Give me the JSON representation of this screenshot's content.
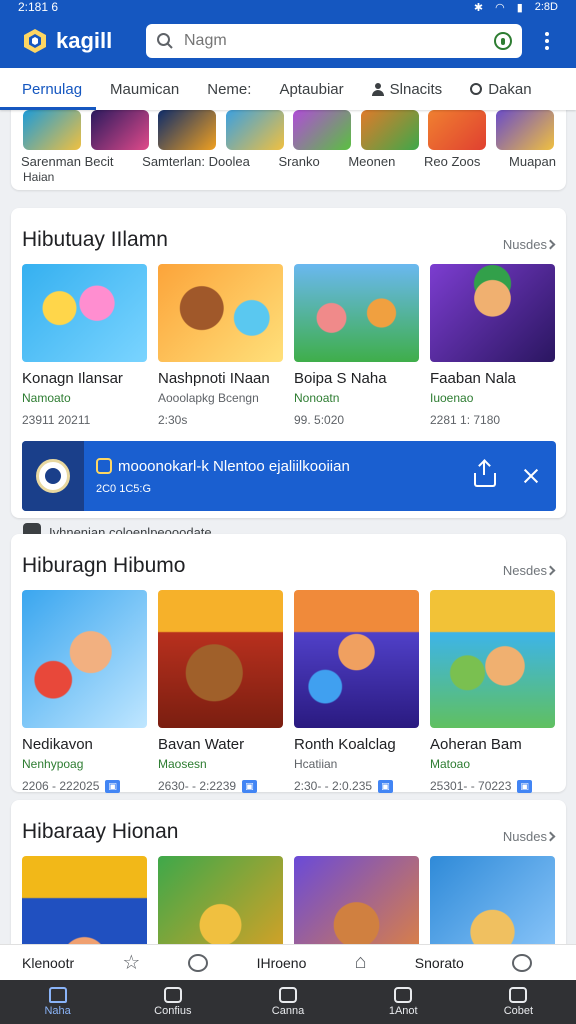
{
  "status": {
    "time": "2:181 6",
    "right_text": "2:8D"
  },
  "app": {
    "name": "kagill",
    "search_placeholder": "Nagm",
    "menu_icon": "kebab-menu-icon"
  },
  "tabs": [
    {
      "label": "Pernulag",
      "active": true
    },
    {
      "label": "Maumican"
    },
    {
      "label": "Neme:"
    },
    {
      "label": "Aptaubiar"
    },
    {
      "label": "Slnacits",
      "icon": "person-icon"
    },
    {
      "label": "Dakan",
      "icon": "circle-icon"
    }
  ],
  "top_strip": {
    "labels": [
      "Sarenman Becit",
      "Samterlan: Doolea",
      "Sranko",
      "Meonen",
      "Reo Zoos",
      "Muapan"
    ],
    "sub": "Haian",
    "colors": [
      "#1d9bd8",
      "#2a1a5e",
      "#0e2c6a",
      "#f0a020",
      "#b04cd8",
      "#2f8ad4",
      "#3ba0e0",
      "#e07a2a",
      "#6a4cc8",
      "#f08030"
    ]
  },
  "section1": {
    "title": "Hibutuay IIlamn",
    "more": "Nusdes",
    "items": [
      {
        "name": "Konagn Ilansar",
        "sub": "Namoato",
        "meta": "23911 20211",
        "c1": "#35b0f0",
        "c2": "#ffd64a"
      },
      {
        "name": "Nashpnoti INaan",
        "sub": "Aooolapkg Bcengn",
        "meta": "2:30s",
        "c1": "#fca43a",
        "c2": "#e2472e"
      },
      {
        "name": "Boipa S Naha",
        "sub": "Nonoatn",
        "meta": "99. 5:020",
        "c1": "#3fae4a",
        "c2": "#2f6fd0"
      },
      {
        "name": "Faaban Nala",
        "sub": "Iuoenao",
        "meta": "2281 1: 7180",
        "c1": "#7c3dd0",
        "c2": "#32a04a"
      }
    ],
    "promo": {
      "title": "mooonokarl-k Nlentoo ejaliilkooiian",
      "sub": "2C0 1C5:G",
      "note": "Ivhnenian coloenlpeooodate."
    }
  },
  "section2": {
    "title": "Hiburagn Hibumo",
    "more": "Nesdes",
    "items": [
      {
        "name": "Nedikavon",
        "sub": "Nenhypoag",
        "meta": "2206 - 222025",
        "c1": "#3aa6ef",
        "c2": "#e8483a"
      },
      {
        "name": "Bavan Water",
        "sub": "Maosesn",
        "meta": "2630- - 2:2239",
        "c1": "#b8301e",
        "c2": "#f6b12a"
      },
      {
        "name": "Ronth Koalclag",
        "sub": "Hcatiian",
        "meta": "2:30- - 2:0.235",
        "c1": "#5040c8",
        "c2": "#f08a3a"
      },
      {
        "name": "Aoheran Bam",
        "sub": "Matoao",
        "meta": "25301- - 70223",
        "c1": "#3db4e8",
        "c2": "#f2c237"
      }
    ]
  },
  "section3": {
    "title": "Hibaraay Hionan",
    "more": "Nusdes",
    "colors": [
      [
        "#2050c0",
        "#f2b818"
      ],
      [
        "#f0a020",
        "#3ea84a"
      ],
      [
        "#6a4ad8",
        "#f08a2a"
      ],
      [
        "#2f8ad8",
        "#f0c040"
      ]
    ]
  },
  "label_strip": [
    {
      "label": "Klenootr"
    },
    {
      "icon": "star-outline-icon"
    },
    {
      "icon": "person-outline-icon"
    },
    {
      "label": "IHroeno"
    },
    {
      "icon": "house-outline-icon"
    },
    {
      "label": "Snorato"
    },
    {
      "icon": "person-outline-icon"
    }
  ],
  "bottom_nav": [
    {
      "label": "Naha",
      "icon": "home-icon",
      "active": true
    },
    {
      "label": "Confius",
      "icon": "flag-icon"
    },
    {
      "label": "Canna",
      "icon": "house-icon"
    },
    {
      "label": "1Anot",
      "icon": "tv-icon"
    },
    {
      "label": "Cobet",
      "icon": "wallet-icon"
    }
  ]
}
